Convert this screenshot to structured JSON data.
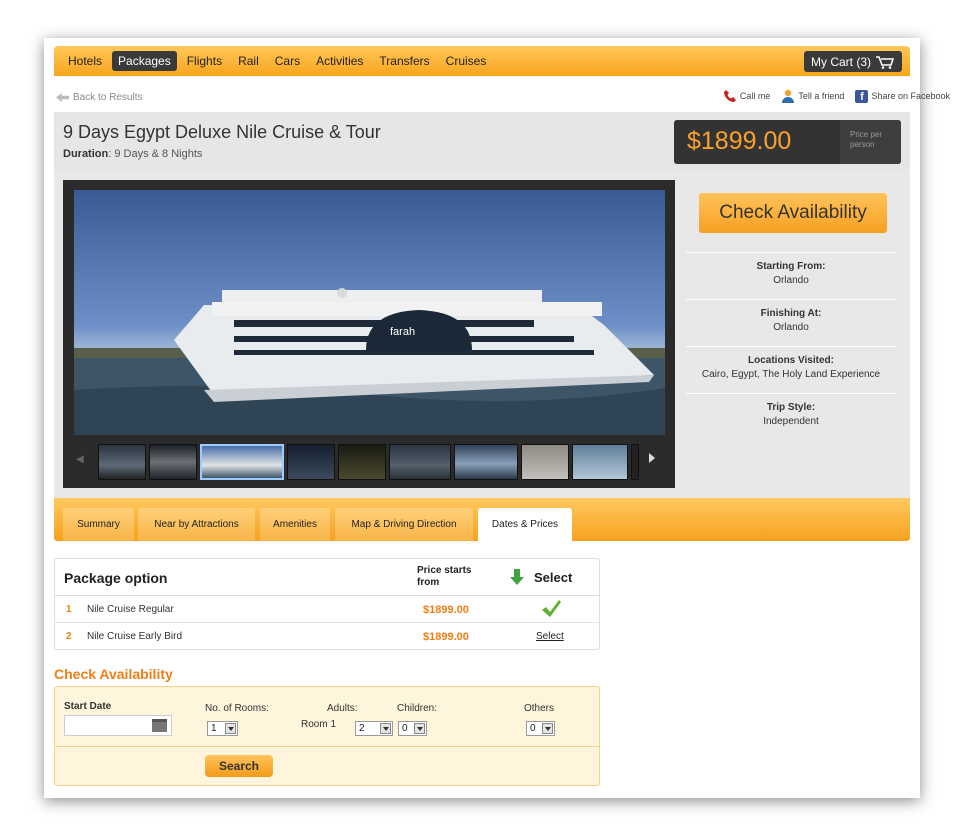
{
  "nav": {
    "items": [
      {
        "label": "Hotels",
        "active": false
      },
      {
        "label": "Packages",
        "active": true
      },
      {
        "label": "Flights",
        "active": false
      },
      {
        "label": "Rail",
        "active": false
      },
      {
        "label": "Cars",
        "active": false
      },
      {
        "label": "Activities",
        "active": false
      },
      {
        "label": "Transfers",
        "active": false
      },
      {
        "label": "Cruises",
        "active": false
      }
    ],
    "cart_label": "My Cart (3)"
  },
  "back_link": "Back to Results",
  "social": {
    "call": "Call me",
    "tell": "Tell a friend",
    "facebook": "Share on Facebook"
  },
  "tour": {
    "title": "9 Days Egypt Deluxe Nile Cruise & Tour",
    "duration_label": "Duration",
    "duration_value": ": 9 Days & 8 Nights",
    "price": "$1899.00",
    "price_note": "Price per person"
  },
  "side": {
    "check_btn": "Check Availability",
    "info": [
      {
        "label": "Starting From:",
        "value": "Orlando"
      },
      {
        "label": "Finishing At:",
        "value": "Orlando"
      },
      {
        "label": "Locations Visited:",
        "value": "Cairo, Egypt, The Holy Land Experience"
      },
      {
        "label": "Trip Style:",
        "value": "Independent"
      }
    ]
  },
  "boat_name": "farah",
  "tabs": [
    {
      "label": "Summary",
      "active": false
    },
    {
      "label": "Near by Attractions",
      "active": false
    },
    {
      "label": "Amenities",
      "active": false
    },
    {
      "label": "Map & Driving Direction",
      "active": false
    },
    {
      "label": "Dates & Prices",
      "active": true
    }
  ],
  "packages": {
    "col_option": "Package option",
    "col_price": "Price starts from",
    "col_select": "Select",
    "rows": [
      {
        "num": "1",
        "name": "Nile Cruise Regular",
        "price": "$1899.00",
        "selected": true,
        "select_label": ""
      },
      {
        "num": "2",
        "name": "Nile Cruise Early Bird",
        "price": "$1899.00",
        "selected": false,
        "select_label": "Select"
      }
    ]
  },
  "availability": {
    "title": "Check Availability",
    "start_date_label": "Start Date",
    "start_date_value": "",
    "rooms_label": "No. of Rooms:",
    "rooms_value": "1",
    "room_label": "Room 1",
    "adults_label": "Adults:",
    "adults_value": "2",
    "children_label": "Children:",
    "children_value": "0",
    "others_label": "Others",
    "others_value": "0",
    "search_btn": "Search"
  }
}
